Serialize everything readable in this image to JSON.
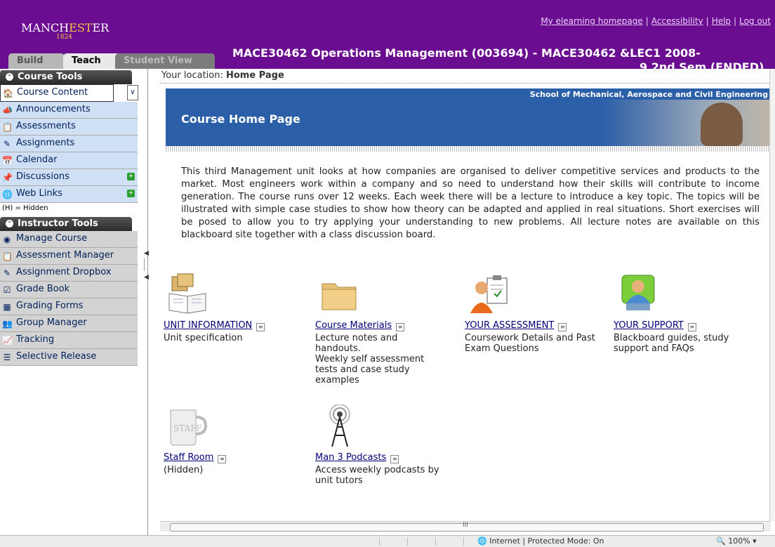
{
  "header": {
    "logo_text_a": "MANCH",
    "logo_text_b": "EST",
    "logo_text_c": "ER",
    "logo_year": "1824",
    "links": [
      "My elearning homepage",
      "Accessibility",
      "Help",
      "Log out"
    ],
    "tabs": [
      "Build",
      "Teach",
      "Student View"
    ],
    "course_title": "MACE30462 Operations Management (003694) - MACE30462 &LEC1 2008-",
    "course_title_line2": "9 2nd Sem (ENDED)"
  },
  "sidebar": {
    "course_tools_title": "Course Tools",
    "course_tools": [
      {
        "label": "Course Content",
        "icon": "home-icon"
      },
      {
        "label": "Announcements",
        "icon": "megaphone-icon"
      },
      {
        "label": "Assessments",
        "icon": "assessment-icon"
      },
      {
        "label": "Assignments",
        "icon": "assignment-icon"
      },
      {
        "label": "Calendar",
        "icon": "calendar-icon"
      },
      {
        "label": "Discussions",
        "icon": "pushpin-icon"
      },
      {
        "label": "Web Links",
        "icon": "globe-icon"
      }
    ],
    "hidden_legend": "(H) = Hidden",
    "instructor_tools_title": "Instructor Tools",
    "instructor_tools": [
      {
        "label": "Manage Course",
        "icon": "cube-icon"
      },
      {
        "label": "Assessment Manager",
        "icon": "assessment-icon"
      },
      {
        "label": "Assignment Dropbox",
        "icon": "dropbox-icon"
      },
      {
        "label": "Grade Book",
        "icon": "gradebook-icon"
      },
      {
        "label": "Grading Forms",
        "icon": "grading-form-icon"
      },
      {
        "label": "Group Manager",
        "icon": "group-icon"
      },
      {
        "label": "Tracking",
        "icon": "chart-icon"
      },
      {
        "label": "Selective Release",
        "icon": "release-icon"
      }
    ]
  },
  "main": {
    "location_label": "Your location:",
    "location_value": "Home Page",
    "banner_dept": "School of Mechanical, Aerospace and Civil Engineering",
    "banner_title": "Course Home Page",
    "intro": "This third Management unit looks at how companies are organised to deliver competitive services and products to the market. Most engineers work within a company and so need to understand how their skills will contribute to income generation. The course runs over 12 weeks. Each week there will be a lecture to introduce a key topic. The topics will be illustrated with simple case studies to show how theory can be adapted and applied in real situations. Short exercises will be posed to allow you to try applying your understanding to new problems. All lecture notes are available on this blackboard site together with a class discussion board.",
    "tiles": [
      {
        "title": "UNIT INFORMATION",
        "desc": "Unit specification",
        "icon": "book-boxes-icon"
      },
      {
        "title": "Course Materials",
        "desc": "Lecture notes and handouts.\nWeekly self assessment tests and case study examples",
        "icon": "folder-icon"
      },
      {
        "title": "YOUR ASSESSMENT",
        "desc": "Coursework Details and Past Exam Questions",
        "icon": "clipboard-person-icon"
      },
      {
        "title": "YOUR SUPPORT",
        "desc": "Blackboard guides, study support and FAQs",
        "icon": "support-person-icon"
      },
      {
        "title": "Staff Room",
        "desc": "(Hidden)",
        "icon": "staff-mug-icon",
        "mug_label": "STAFF"
      },
      {
        "title": "Man 3 Podcasts",
        "desc": "Access weekly podcasts by unit tutors",
        "icon": "antenna-icon"
      }
    ]
  },
  "statusbar": {
    "zone": "Internet | Protected Mode: On",
    "zoom": "100%",
    "scroll_label": "III"
  }
}
